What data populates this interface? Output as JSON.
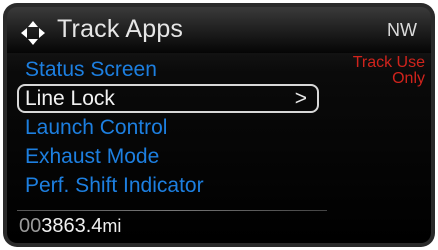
{
  "header": {
    "title": "Track Apps",
    "compass": "NW",
    "nav_icon": "dpad-arrows-icon"
  },
  "menu": {
    "items": [
      {
        "label": "Status Screen",
        "selected": false
      },
      {
        "label": "Line Lock",
        "selected": true,
        "chevron": ">"
      },
      {
        "label": "Launch Control",
        "selected": false
      },
      {
        "label": "Exhaust Mode",
        "selected": false
      },
      {
        "label": "Perf. Shift Indicator",
        "selected": false
      }
    ]
  },
  "notice": {
    "line1": "Track Use",
    "line2": "Only"
  },
  "odometer": {
    "leading_zeros": "00",
    "value": "3863.4",
    "unit": "mi"
  },
  "colors": {
    "menu_text": "#1d7fe0",
    "selected_text": "#f2f2f2",
    "notice": "#d0231c",
    "background": "#000000"
  }
}
